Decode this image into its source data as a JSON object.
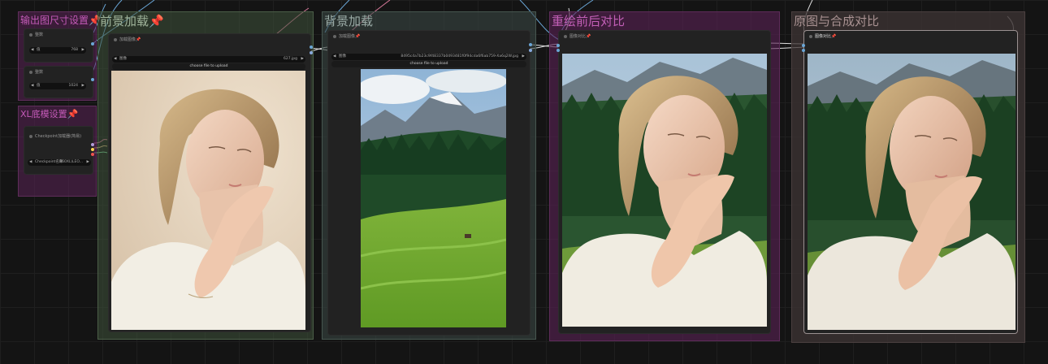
{
  "groups": {
    "output_size": {
      "title": "输出图尺寸设置",
      "pin": "📌",
      "color": "#4a2046"
    },
    "xl_model": {
      "title": "XL底模设置",
      "pin": "📌",
      "color": "#4a2046"
    },
    "foreground": {
      "title": "前景加载",
      "pin": "📌",
      "color": "#3b4a38"
    },
    "background": {
      "title": "背景加载",
      "color": "#384643"
    },
    "relight_compare": {
      "title": "重绘前后对比",
      "color": "#4a2246"
    },
    "composite_compare": {
      "title": "原图与合成对比",
      "color": "#3e3434"
    }
  },
  "nodes": {
    "width": {
      "head": "整数",
      "prefix": "值",
      "value": "768"
    },
    "height": {
      "head": "整数",
      "prefix": "值",
      "value": "1024"
    },
    "checkpoint": {
      "head": "Checkpoint加载器(简易)",
      "field_label": "Checkpoint名称",
      "field_value": "860XL\\LEO..."
    },
    "fg_loader": {
      "head": "加载图像",
      "pin": "📌",
      "field_label": "图像",
      "filename": "627.jpg",
      "upload_label": "choose file to upload"
    },
    "bg_loader": {
      "head": "加载图像",
      "pin": "📌",
      "field_label": "图像",
      "filename": "8495c4a7b23c9f48337b0493481f0f94cda6f6ab759-Xa6q2W.jpg",
      "upload_label": "choose file to upload"
    },
    "relight_cmp": {
      "head": "图像对比",
      "pin": "📌"
    },
    "composite_cmp": {
      "head": "图像对比",
      "pin": "📌"
    }
  },
  "images": {
    "foreground_photo": "woman-portrait-beige-background",
    "background_photo": "alpine-meadow-mountain",
    "relight_result": "woman-portrait-forest-mountain",
    "composite_result": "woman-portrait-forest-mountain"
  },
  "colors": {
    "canvas": "#141414",
    "link_blue": "#6aa6d6",
    "link_pink": "#d87a9a",
    "link_white": "#dddddd"
  }
}
